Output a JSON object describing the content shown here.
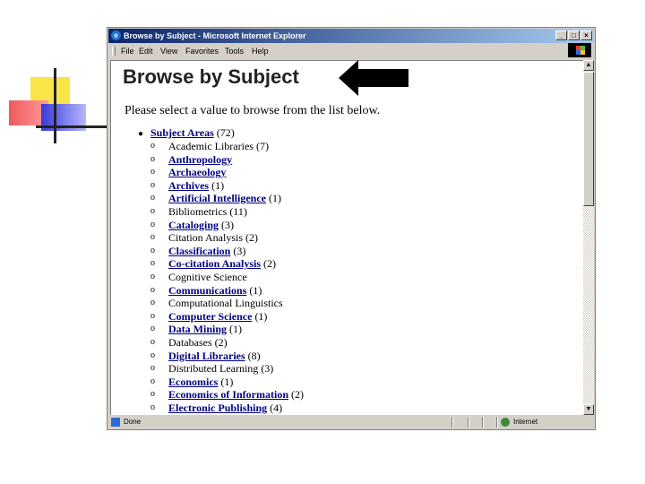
{
  "window": {
    "title": "Browse by Subject - Microsoft Internet Explorer",
    "buttons": {
      "minimize": "_",
      "maximize": "□",
      "close": "×"
    }
  },
  "menu": [
    "File",
    "Edit",
    "View",
    "Favorites",
    "Tools",
    "Help"
  ],
  "page": {
    "title": "Browse by Subject",
    "instructions": "Please select a value to browse from the list below.",
    "root": {
      "label": "Subject Areas",
      "count": "(72)"
    },
    "items": [
      {
        "label": "Academic Libraries",
        "count": "(7)",
        "link": false
      },
      {
        "label": "Anthropology",
        "count": "",
        "link": true
      },
      {
        "label": "Archaeology",
        "count": "",
        "link": true
      },
      {
        "label": "Archives",
        "count": "(1)",
        "link": true
      },
      {
        "label": "Artificial Intelligence",
        "count": "(1)",
        "link": true
      },
      {
        "label": "Bibliometrics",
        "count": "(11)",
        "link": false
      },
      {
        "label": "Cataloging",
        "count": "(3)",
        "link": true
      },
      {
        "label": "Citation Analysis",
        "count": "(2)",
        "link": false
      },
      {
        "label": "Classification",
        "count": "(3)",
        "link": true
      },
      {
        "label": "Co-citation Analysis",
        "count": "(2)",
        "link": true
      },
      {
        "label": "Cognitive Science",
        "count": "",
        "link": false
      },
      {
        "label": "Communications",
        "count": "(1)",
        "link": true
      },
      {
        "label": "Computational Linguistics",
        "count": "",
        "link": false
      },
      {
        "label": "Computer Science",
        "count": "(1)",
        "link": true
      },
      {
        "label": "Data Mining",
        "count": "(1)",
        "link": true
      },
      {
        "label": "Databases",
        "count": "(2)",
        "link": false
      },
      {
        "label": "Digital Libraries",
        "count": "(8)",
        "link": true
      },
      {
        "label": "Distributed Learning",
        "count": "(3)",
        "link": false
      },
      {
        "label": "Economics",
        "count": "(1)",
        "link": true
      },
      {
        "label": "Economics of Information",
        "count": "(2)",
        "link": true
      },
      {
        "label": "Electronic Publishing",
        "count": "(4)",
        "link": true
      }
    ]
  },
  "status": {
    "text": "Done",
    "zone": "Internet"
  },
  "icons": {
    "window": "ie-icon",
    "scroll_up": "arrow-up-icon",
    "scroll_down": "arrow-down-icon",
    "status": "page-icon",
    "zone": "globe-icon",
    "pointer": "arrow-left-icon"
  },
  "colors": {
    "titlebar": "#0a246a",
    "link": "#00007f",
    "chrome": "#d4d0c8"
  }
}
